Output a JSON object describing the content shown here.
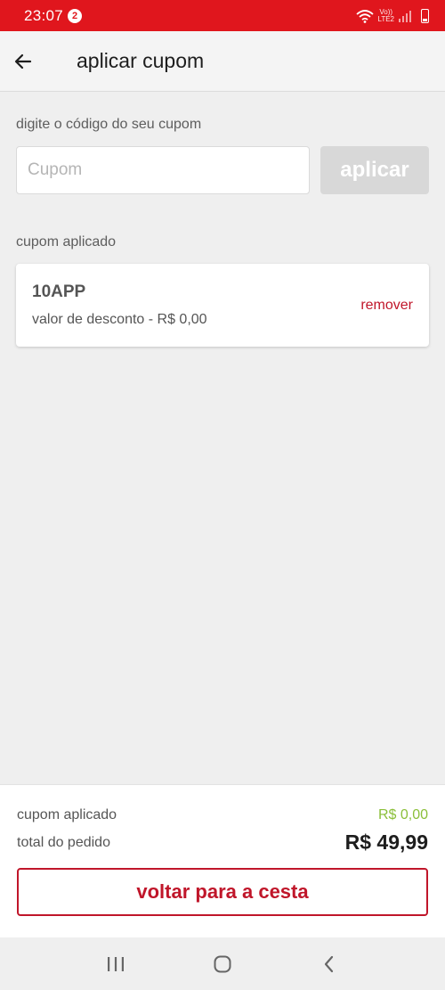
{
  "status_bar": {
    "time": "23:07",
    "notification_count": "2",
    "network_label_top": "Vo))",
    "network_label_bottom": "LTE2"
  },
  "header": {
    "title": "aplicar cupom"
  },
  "coupon_form": {
    "label": "digite o código do seu cupom",
    "input_value": "",
    "input_placeholder": "Cupom",
    "apply_label": "aplicar"
  },
  "applied_section": {
    "label": "cupom aplicado",
    "code": "10APP",
    "discount_text": "valor de desconto - R$ 0,00",
    "remove_label": "remover"
  },
  "summary": {
    "coupon_label": "cupom aplicado",
    "coupon_value": "R$ 0,00",
    "total_label": "total do pedido",
    "total_value": "R$ 49,99",
    "back_button_label": "voltar para a cesta"
  },
  "colors": {
    "brand_red": "#e0161d",
    "accent_red": "#c0162a",
    "discount_green": "#8bbf3a"
  },
  "icons": {
    "back": "arrow-left-icon",
    "nav_recents": "recents-icon",
    "nav_home": "home-icon",
    "nav_back": "chevron-left-icon"
  }
}
